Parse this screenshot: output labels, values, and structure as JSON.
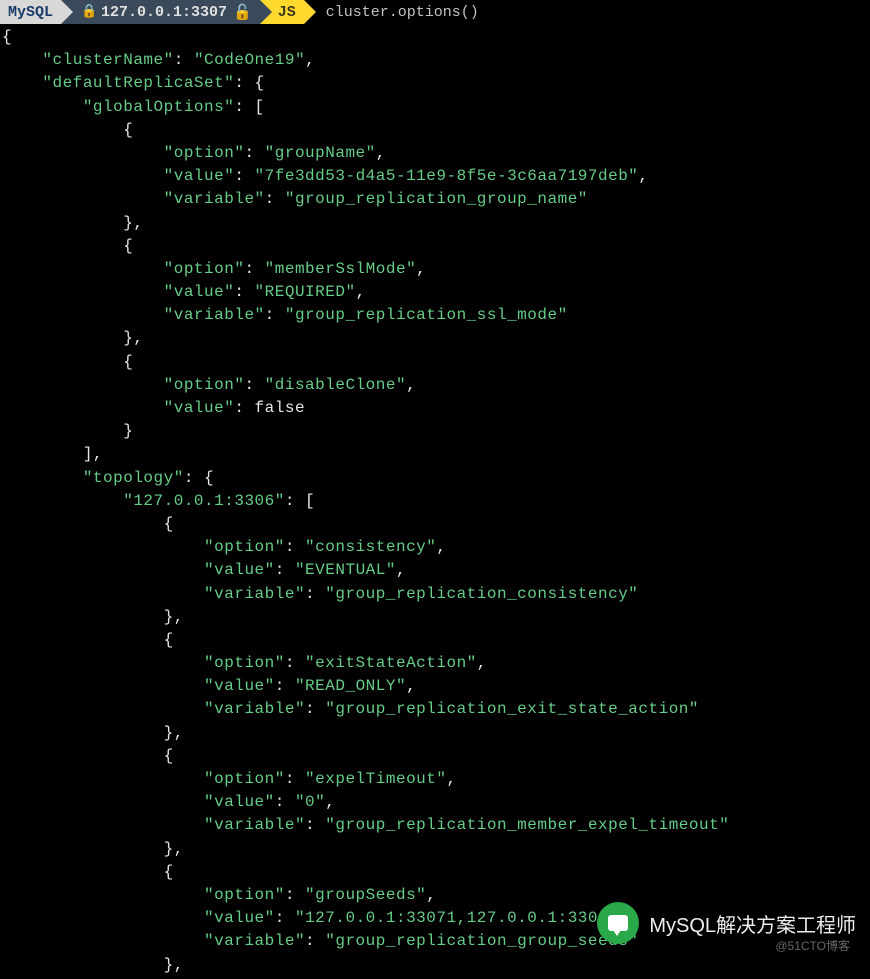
{
  "prompt": {
    "mysql_label": "MySQL",
    "host": "127.0.0.1:3307",
    "mode": "JS",
    "command": "cluster.options()"
  },
  "watermark": {
    "main": "MySQL解决方案工程师",
    "sub": "@51CTO博客"
  },
  "result": {
    "clusterName": "CodeOne19",
    "defaultReplicaSet": {
      "globalOptions": [
        {
          "option": "groupName",
          "value": "7fe3dd53-d4a5-11e9-8f5e-3c6aa7197deb",
          "variable": "group_replication_group_name"
        },
        {
          "option": "memberSslMode",
          "value": "REQUIRED",
          "variable": "group_replication_ssl_mode"
        },
        {
          "option": "disableClone",
          "value_nonstring": "false"
        }
      ],
      "topology": {
        "127.0.0.1:3306": [
          {
            "option": "consistency",
            "value": "EVENTUAL",
            "variable": "group_replication_consistency"
          },
          {
            "option": "exitStateAction",
            "value": "READ_ONLY",
            "variable": "group_replication_exit_state_action"
          },
          {
            "option": "expelTimeout",
            "value": "0",
            "variable": "group_replication_member_expel_timeout"
          },
          {
            "option": "groupSeeds",
            "value": "127.0.0.1:33071,127.0.0.1:33081",
            "variable": "group_replication_group_seeds",
            "truncated_after": true
          }
        ]
      }
    }
  }
}
